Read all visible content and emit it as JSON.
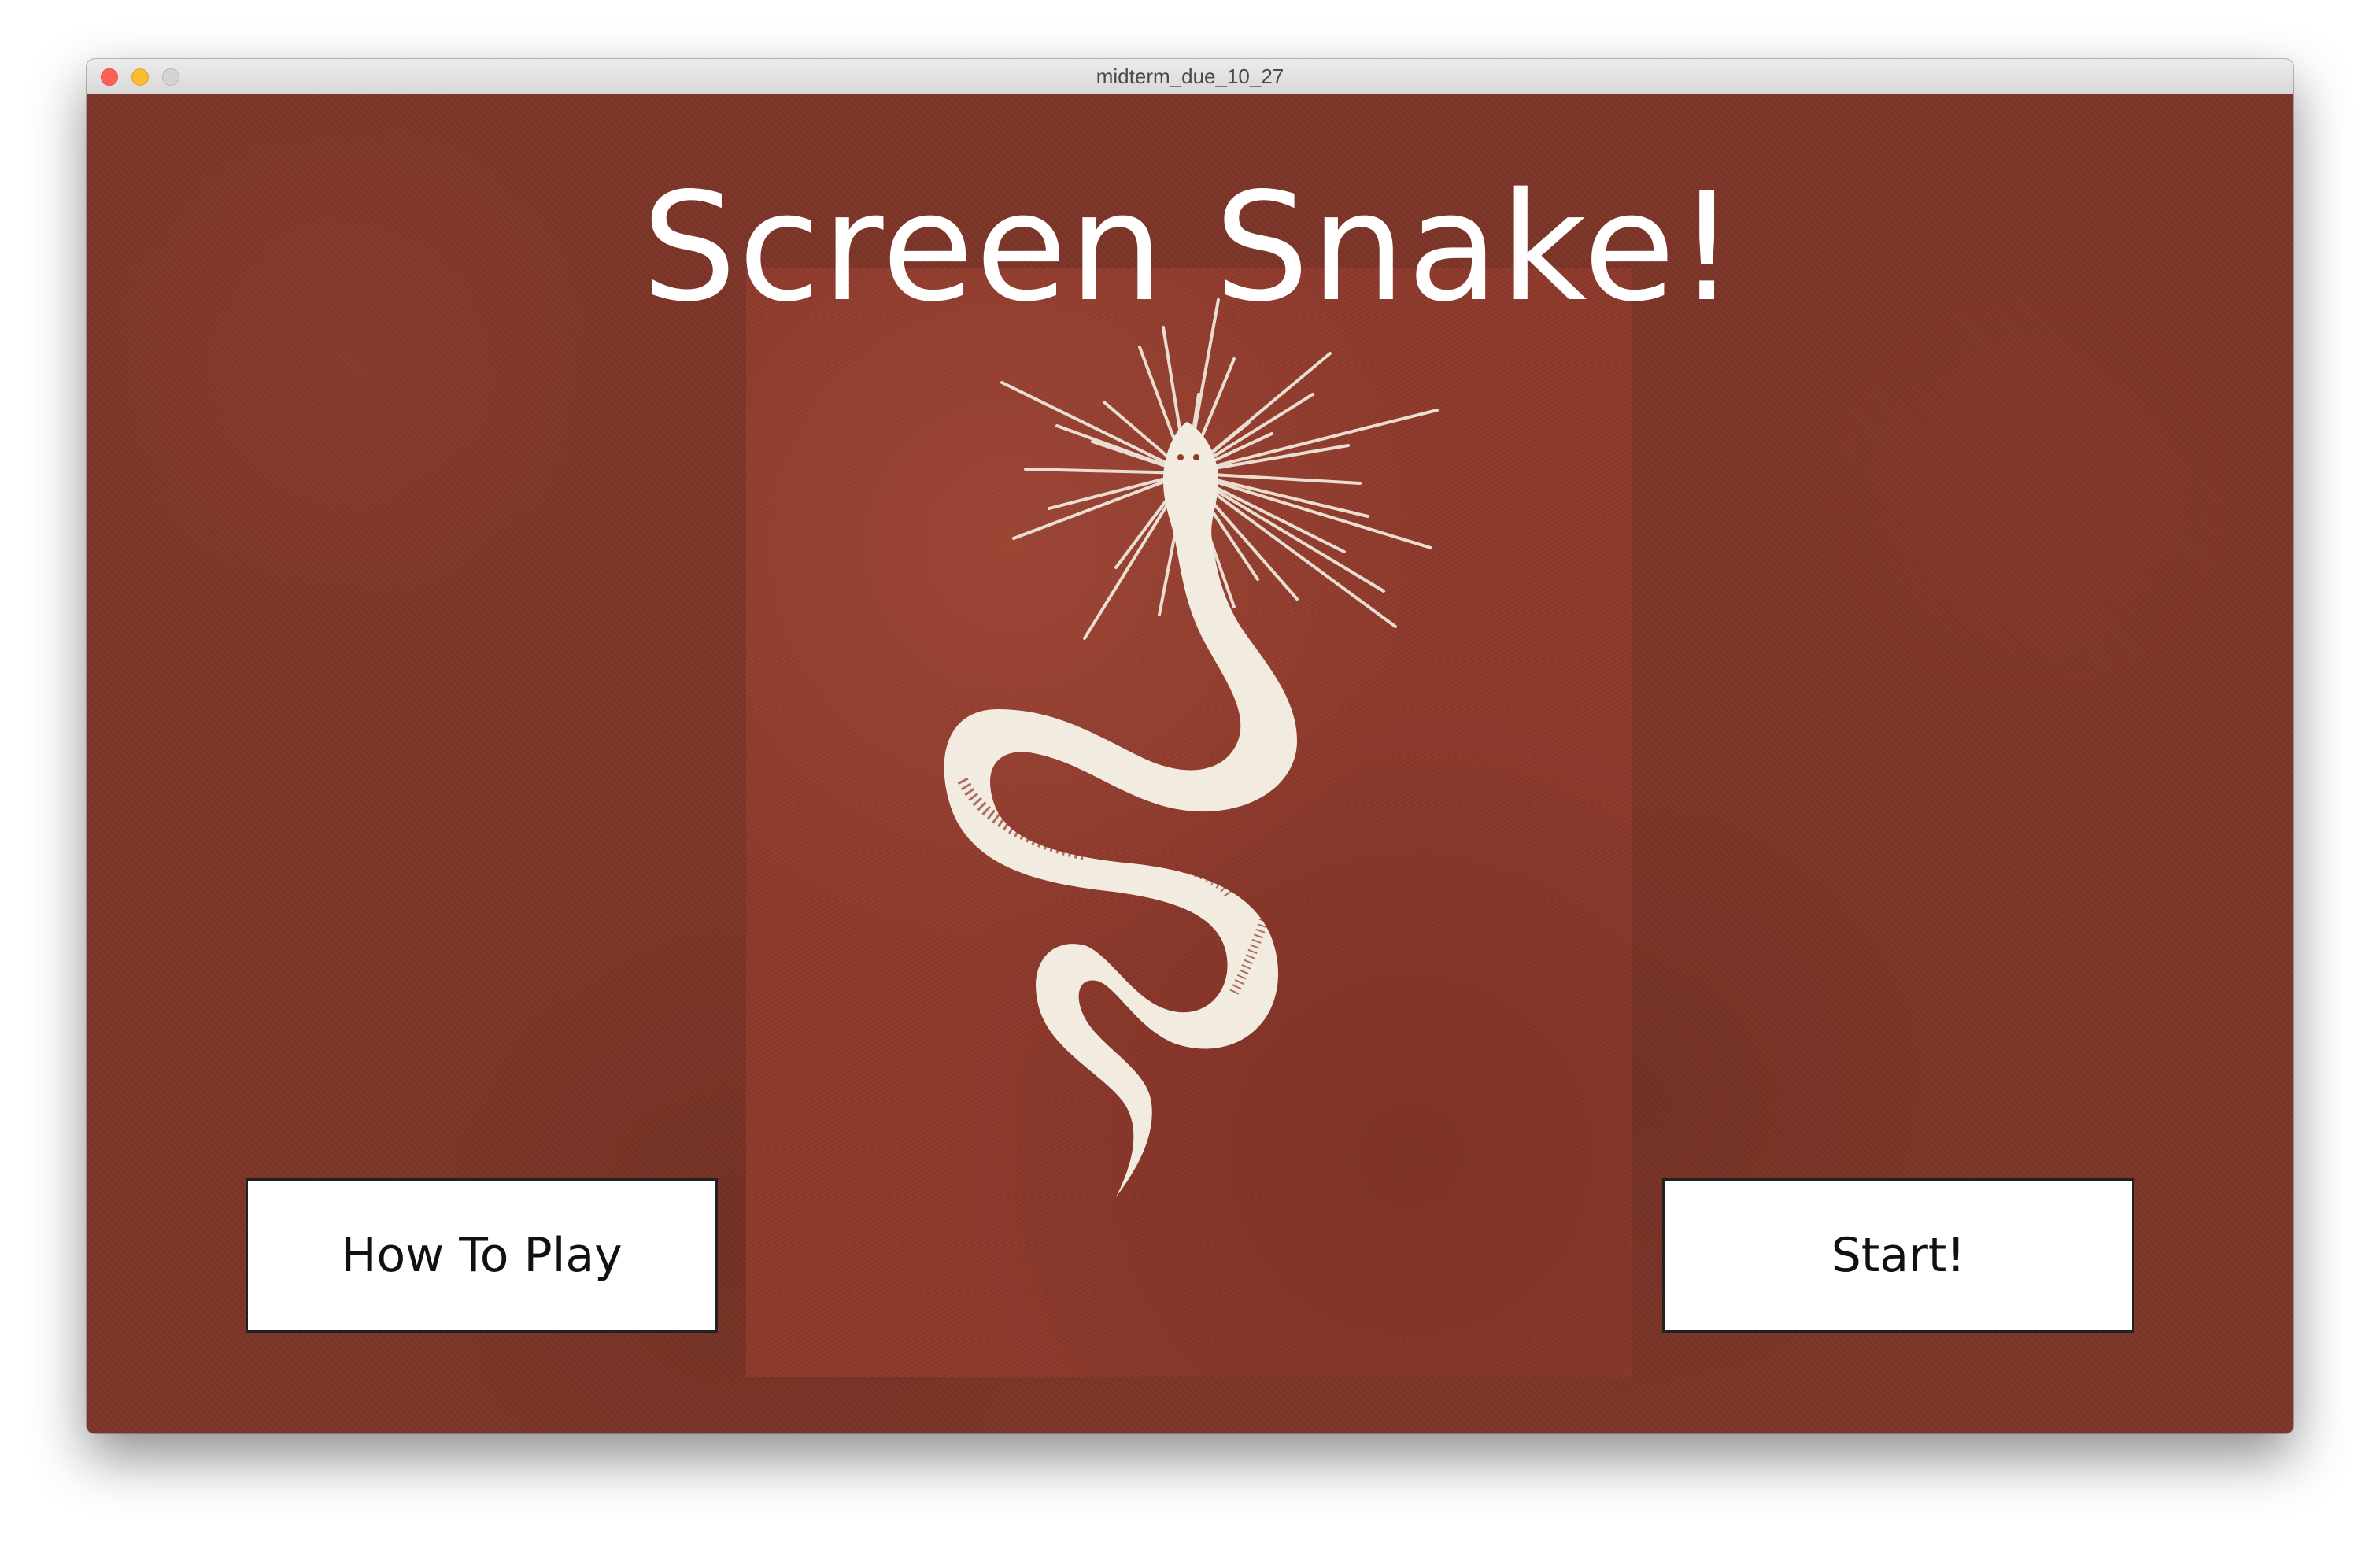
{
  "window": {
    "title": "midterm_due_10_27",
    "controls": [
      "close",
      "minimize",
      "zoom"
    ]
  },
  "game": {
    "title": "Screen Snake!",
    "art": "snake-with-sunburst-icon",
    "buttons": {
      "how_to_play": "How To Play",
      "start": "Start!"
    }
  },
  "colors": {
    "background": "#7c3528",
    "poster": "#8e3a2c",
    "snake": "#f1ebe0",
    "title_text": "#ffffff",
    "button_fill": "#ffffff",
    "button_text": "#111111"
  }
}
